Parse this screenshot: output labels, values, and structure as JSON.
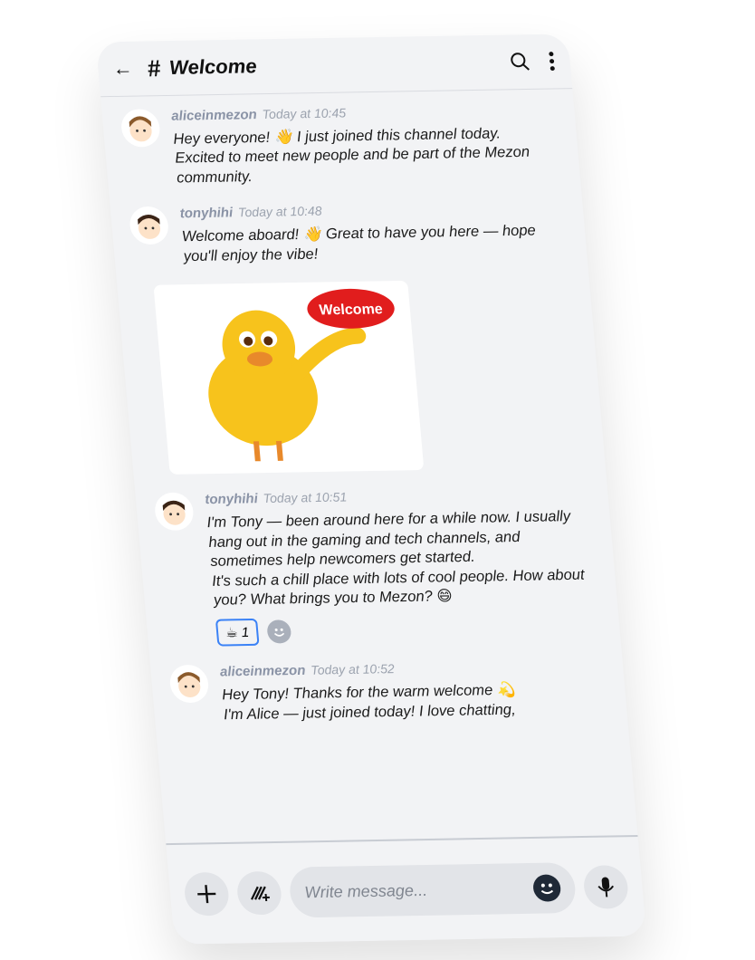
{
  "header": {
    "back_icon": "arrow-left-icon",
    "hash": "#",
    "title": "Welcome",
    "search_icon": "search-icon",
    "more_icon": "more-vertical-icon"
  },
  "messages": [
    {
      "user": "aliceinmezon",
      "time": "Today at 10:45",
      "text": "Hey everyone! 👋 I just joined this channel today.\nExcited to meet new people and be part of the Mezon community."
    },
    {
      "user": "tonyhihi",
      "time": "Today at 10:48",
      "text": "Welcome aboard! 👋 Great to have you here — hope you'll enjoy the vibe!",
      "sticker_label": "Welcome"
    },
    {
      "user": "tonyhihi",
      "time": "Today at 10:51",
      "text": "I'm Tony — been around here for a while now. I usually hang out in the gaming and tech channels, and sometimes help newcomers get started.\nIt's such a chill place with lots of cool people. How about you? What brings you to Mezon? 😄",
      "reaction": {
        "emoji": "☕",
        "count": "1"
      }
    },
    {
      "user": "aliceinmezon",
      "time": "Today at 10:52",
      "text": "Hey Tony! Thanks for the warm welcome 💫\nI'm Alice — just joined today! I love chatting,"
    }
  ],
  "composer": {
    "placeholder": "Write message...",
    "plus_icon": "plus-icon",
    "sticker_icon": "sticker-icon",
    "emoji_icon": "emoji-icon",
    "mic_icon": "mic-icon"
  },
  "colors": {
    "username": "#8a93a6",
    "reaction_border": "#3b82f6",
    "background": "#f2f3f5"
  }
}
